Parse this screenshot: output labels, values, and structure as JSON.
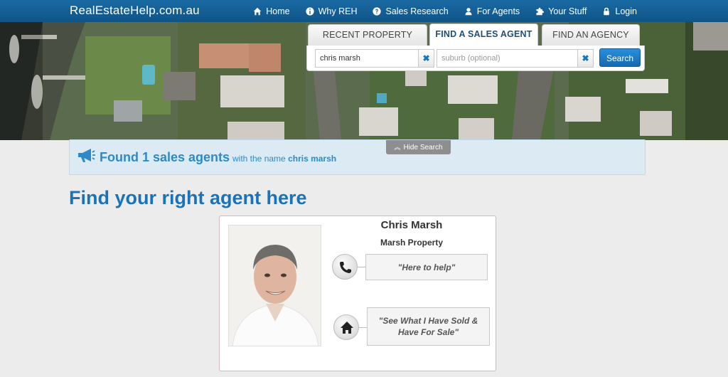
{
  "nav": {
    "logo": "RealEstateHelp.com.au",
    "items": [
      {
        "label": "Home",
        "icon": "home-icon"
      },
      {
        "label": "Why REH",
        "icon": "info-icon"
      },
      {
        "label": "Sales Research",
        "icon": "question-icon"
      },
      {
        "label": "For Agents",
        "icon": "user-icon"
      },
      {
        "label": "Your Stuff",
        "icon": "puzzle-icon"
      },
      {
        "label": "Login",
        "icon": "lock-icon"
      }
    ]
  },
  "search": {
    "tabs": [
      {
        "label": "RECENT PROPERTY SALES",
        "active": false
      },
      {
        "label": "FIND A SALES AGENT",
        "active": true
      },
      {
        "label": "FIND AN AGENCY",
        "active": false
      }
    ],
    "name_value": "chris marsh",
    "suburb_placeholder": "suburb (optional)",
    "clear_glyph": "✖",
    "button_label": "Search"
  },
  "results": {
    "hide_label": "Hide Search",
    "found_text": "Found 1 sales agents",
    "with_name_prefix": "with the name",
    "with_name_value": "chris marsh"
  },
  "page_title": "Find your right agent here",
  "agent": {
    "name": "Chris Marsh",
    "agency": "Marsh Property",
    "phone_text": "\"Here to help\"",
    "home_text_line1": "\"See What I Have Sold &",
    "home_text_line2": "Have For Sale\""
  },
  "colors": {
    "nav_bg": "#1a6aa3",
    "accent_blue": "#1a73b8",
    "banner_bg": "#dceaf3",
    "search_button": "#1d79c4"
  }
}
